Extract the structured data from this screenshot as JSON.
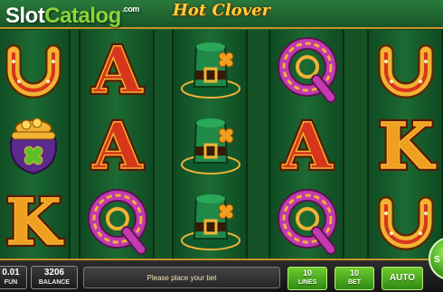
{
  "watermark": {
    "part1": "Slot",
    "part2": "Catalog",
    "suffix": ".com"
  },
  "game": {
    "title": "Hot Clover"
  },
  "reels": [
    {
      "symbols": [
        "horseshoe",
        "pot-of-gold",
        "letter-k"
      ]
    },
    {
      "symbols": [
        "letter-a",
        "letter-a",
        "letter-q"
      ]
    },
    {
      "symbols": [
        "leprechaun-hat",
        "leprechaun-hat",
        "leprechaun-hat"
      ]
    },
    {
      "symbols": [
        "letter-q",
        "letter-a",
        "letter-q"
      ]
    },
    {
      "symbols": [
        "horseshoe",
        "letter-k",
        "horseshoe"
      ]
    }
  ],
  "symbol_letters": {
    "letter-a": "A",
    "letter-k": "K",
    "letter-q": "Q"
  },
  "bottom_bar": {
    "fun_value": "0.01",
    "fun_label": "FUN",
    "balance_value": "3206",
    "balance_label": "BALANCE",
    "message": "Please place your bet",
    "lines_value": "10",
    "lines_label": "LINES",
    "bet_value": "10",
    "bet_label": "BET",
    "auto_label": "AUTO",
    "spin_label": "S"
  },
  "colors": {
    "accent_green": "#5fbf2a",
    "gold": "#f2b233",
    "letter_red": "#d8361c",
    "letter_orange": "#f0a020",
    "q_magenta": "#c23ab0",
    "hat_green": "#1f8a48"
  }
}
